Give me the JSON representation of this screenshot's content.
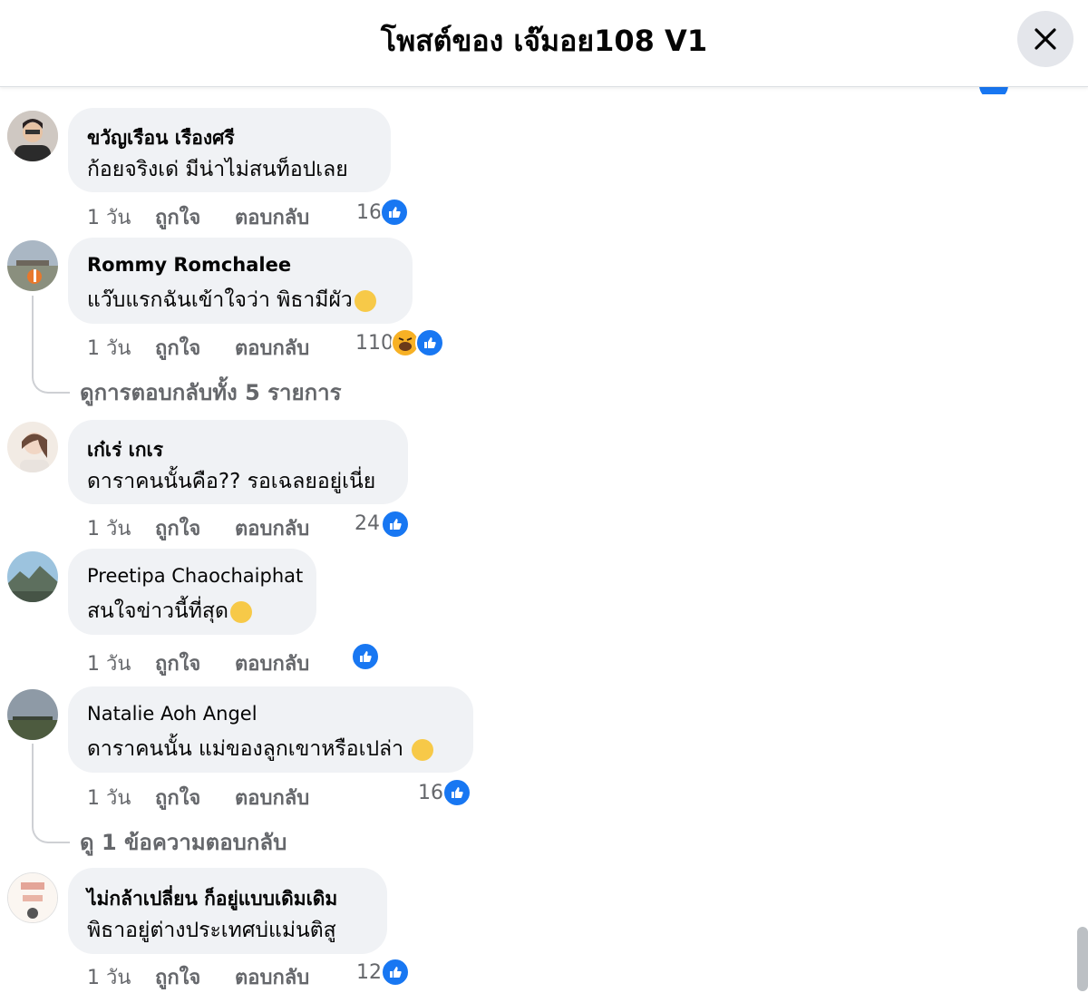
{
  "header": {
    "title": "โพสต์ของ เจ๊มอย108 V1"
  },
  "actions": {
    "like": "ถูกใจ",
    "reply": "ตอบกลับ"
  },
  "comments": [
    {
      "author": "ขวัญเรือน เรืองศรี",
      "text": "ก้อยจริงเด่ มีน่าไม่สนท็อปเลย",
      "time": "1 วัน",
      "likes": "16"
    },
    {
      "author": "Rommy Romchalee",
      "text": "แว๊บแรกฉันเข้าใจว่า พิธามีผัว",
      "time": "1 วัน",
      "likes": "110",
      "replies_link": "ดูการตอบกลับทั้ง 5 รายการ"
    },
    {
      "author": "เก๋เร่ เกเร",
      "text": "ดาราคนนั้นคือ?? รอเฉลยอยู่เนี่ย",
      "time": "1 วัน",
      "likes": "24"
    },
    {
      "author": "Preetipa Chaochaiphat",
      "text": "สนใจข่าวนี้ที่สุด",
      "time": "1 วัน",
      "likes": ""
    },
    {
      "author": "Natalie Aoh Angel",
      "text": "ดาราคนนั้น แม่ของลูกเขาหรือเปล่า",
      "time": "1 วัน",
      "likes": "16",
      "replies_link": "ดู 1 ข้อความตอบกลับ"
    },
    {
      "author": "ไม่กล้าเปลี่ยน ก็อยู่แบบเดิมเดิม",
      "text": "พิธาอยู่ต่างประเทศบ่แม่นติสู",
      "time": "1 วัน",
      "likes": "12"
    }
  ],
  "colors": {
    "bubble": "#f0f2f5",
    "like_blue": "#1877f2",
    "meta_gray": "#65676b"
  },
  "icons": {
    "close": "close-icon",
    "like": "thumbs-up-icon",
    "haha": "haha-reaction-icon"
  }
}
